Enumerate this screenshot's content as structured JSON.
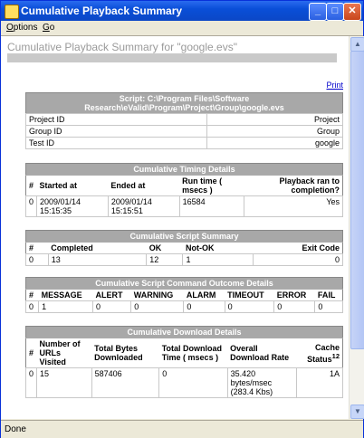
{
  "window": {
    "title": "Cumulative Playback Summary"
  },
  "menu": {
    "options": "Options",
    "options_key": "O",
    "go": "Go",
    "go_key": "G"
  },
  "page": {
    "heading": "Cumulative Playback Summary for \"google.evs\"",
    "print_link": "Print"
  },
  "script_table": {
    "caption": "Script: C:\\Program Files\\Software Research\\eValid\\Program\\Project\\Group\\google.evs",
    "rows": [
      {
        "label": "Project ID",
        "value": "Project"
      },
      {
        "label": "Group ID",
        "value": "Group"
      },
      {
        "label": "Test ID",
        "value": "google"
      }
    ]
  },
  "timing_table": {
    "caption": "Cumulative Timing Details",
    "headers": [
      "#",
      "Started at",
      "Ended at",
      "Run time ( msecs )",
      "Playback ran to completion?"
    ],
    "row": [
      "0",
      "2009/01/14 15:15:35",
      "2009/01/14 15:15:51",
      "16584",
      "Yes"
    ]
  },
  "script_summary_table": {
    "caption": "Cumulative Script Summary",
    "headers": [
      "#",
      "Completed",
      "OK",
      "Not-OK",
      "Exit Code"
    ],
    "row": [
      "0",
      "13",
      "12",
      "1",
      "0"
    ]
  },
  "outcome_table": {
    "caption": "Cumulative Script Command Outcome Details",
    "headers": [
      "#",
      "MESSAGE",
      "ALERT",
      "WARNING",
      "ALARM",
      "TIMEOUT",
      "ERROR",
      "FAIL"
    ],
    "row": [
      "0",
      "1",
      "0",
      "0",
      "0",
      "0",
      "0",
      "0"
    ]
  },
  "download_table": {
    "caption": "Cumulative Download Details",
    "headers": [
      "#",
      "Number of URLs Visited",
      "Total Bytes Downloaded",
      "Total Download Time ( msecs )",
      "Overall Download Rate",
      "Cache Status"
    ],
    "cache_sup": "12",
    "row": [
      "0",
      "15",
      "587406",
      "0",
      "35.420 bytes/msec (283.4 Kbs)",
      "1A"
    ]
  },
  "status": {
    "text": "Done"
  }
}
